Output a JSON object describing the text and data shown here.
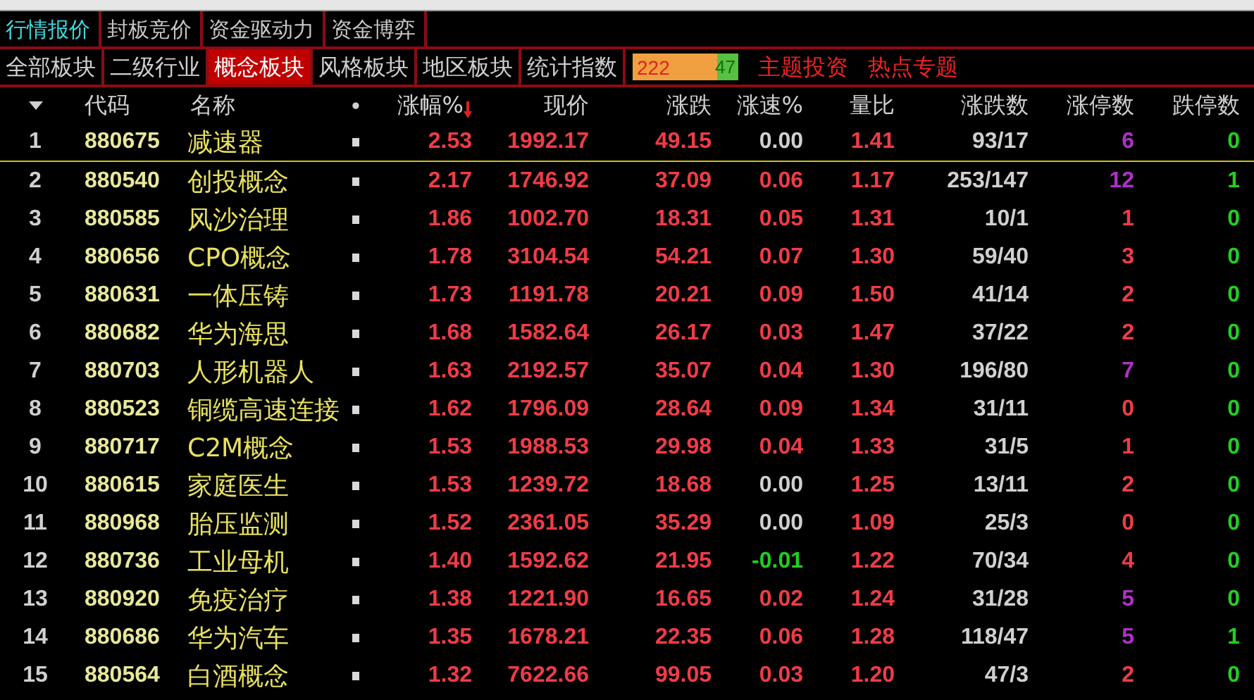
{
  "top_tabs": [
    {
      "label": "行情报价",
      "selected": true
    },
    {
      "label": "封板竞价",
      "selected": false
    },
    {
      "label": "资金驱动力",
      "selected": false
    },
    {
      "label": "资金博弈",
      "selected": false
    }
  ],
  "sector_tabs": [
    {
      "label": "全部板块",
      "selected": false
    },
    {
      "label": "二级行业",
      "selected": false
    },
    {
      "label": "概念板块",
      "selected": true
    },
    {
      "label": "风格板块",
      "selected": false
    },
    {
      "label": "地区板块",
      "selected": false
    },
    {
      "label": "统计指数",
      "selected": false
    }
  ],
  "breadth": {
    "up": "222",
    "down": "47",
    "level": 0.8
  },
  "links": [
    "主题投资",
    "热点专题"
  ],
  "table": {
    "columns": [
      {
        "label": "代码",
        "sorted": false
      },
      {
        "label": "名称",
        "sorted": false
      },
      {
        "label": "•",
        "sorted": false
      },
      {
        "label": "涨幅%",
        "sorted": true
      },
      {
        "label": "现价",
        "sorted": false
      },
      {
        "label": "涨跌",
        "sorted": false
      },
      {
        "label": "涨速%",
        "sorted": false
      },
      {
        "label": "量比",
        "sorted": false
      },
      {
        "label": "涨跌数",
        "sorted": false
      },
      {
        "label": "涨停数",
        "sorted": false
      },
      {
        "label": "跌停数",
        "sorted": false
      }
    ],
    "rows": [
      {
        "index": "1",
        "code": "880675",
        "name": "减速器",
        "change": "2.53",
        "price": "1992.17",
        "diff": "49.15",
        "speed": {
          "text": "0.00",
          "color": "#d0d0d0"
        },
        "ratio": "1.41",
        "updown": "93/17",
        "limit_up": {
          "text": "6",
          "color": "#b030c8"
        },
        "limit_down": "0",
        "selected": true
      },
      {
        "index": "2",
        "code": "880540",
        "name": "创投概念",
        "change": "2.17",
        "price": "1746.92",
        "diff": "37.09",
        "speed": {
          "text": "0.06",
          "color": "#f03c46"
        },
        "ratio": "1.17",
        "updown": "253/147",
        "limit_up": {
          "text": "12",
          "color": "#b030c8"
        },
        "limit_down": "1",
        "selected": false
      },
      {
        "index": "3",
        "code": "880585",
        "name": "风沙治理",
        "change": "1.86",
        "price": "1002.70",
        "diff": "18.31",
        "speed": {
          "text": "0.05",
          "color": "#f03c46"
        },
        "ratio": "1.31",
        "updown": "10/1",
        "limit_up": {
          "text": "1",
          "color": "#f03c46"
        },
        "limit_down": "0",
        "selected": false
      },
      {
        "index": "4",
        "code": "880656",
        "name": "CPO概念",
        "change": "1.78",
        "price": "3104.54",
        "diff": "54.21",
        "speed": {
          "text": "0.07",
          "color": "#f03c46"
        },
        "ratio": "1.30",
        "updown": "59/40",
        "limit_up": {
          "text": "3",
          "color": "#f03c46"
        },
        "limit_down": "0",
        "selected": false
      },
      {
        "index": "5",
        "code": "880631",
        "name": "一体压铸",
        "change": "1.73",
        "price": "1191.78",
        "diff": "20.21",
        "speed": {
          "text": "0.09",
          "color": "#f03c46"
        },
        "ratio": "1.50",
        "updown": "41/14",
        "limit_up": {
          "text": "2",
          "color": "#f03c46"
        },
        "limit_down": "0",
        "selected": false
      },
      {
        "index": "6",
        "code": "880682",
        "name": "华为海思",
        "change": "1.68",
        "price": "1582.64",
        "diff": "26.17",
        "speed": {
          "text": "0.03",
          "color": "#f03c46"
        },
        "ratio": "1.47",
        "updown": "37/22",
        "limit_up": {
          "text": "2",
          "color": "#f03c46"
        },
        "limit_down": "0",
        "selected": false
      },
      {
        "index": "7",
        "code": "880703",
        "name": "人形机器人",
        "change": "1.63",
        "price": "2192.57",
        "diff": "35.07",
        "speed": {
          "text": "0.04",
          "color": "#f03c46"
        },
        "ratio": "1.30",
        "updown": "196/80",
        "limit_up": {
          "text": "7",
          "color": "#b030c8"
        },
        "limit_down": "0",
        "selected": false
      },
      {
        "index": "8",
        "code": "880523",
        "name": "铜缆高速连接",
        "change": "1.62",
        "price": "1796.09",
        "diff": "28.64",
        "speed": {
          "text": "0.09",
          "color": "#f03c46"
        },
        "ratio": "1.34",
        "updown": "31/11",
        "limit_up": {
          "text": "0",
          "color": "#f03c46"
        },
        "limit_down": "0",
        "selected": false
      },
      {
        "index": "9",
        "code": "880717",
        "name": "C2M概念",
        "change": "1.53",
        "price": "1988.53",
        "diff": "29.98",
        "speed": {
          "text": "0.04",
          "color": "#f03c46"
        },
        "ratio": "1.33",
        "updown": "31/5",
        "limit_up": {
          "text": "1",
          "color": "#f03c46"
        },
        "limit_down": "0",
        "selected": false
      },
      {
        "index": "10",
        "code": "880615",
        "name": "家庭医生",
        "change": "1.53",
        "price": "1239.72",
        "diff": "18.68",
        "speed": {
          "text": "0.00",
          "color": "#d0d0d0"
        },
        "ratio": "1.25",
        "updown": "13/11",
        "limit_up": {
          "text": "2",
          "color": "#f03c46"
        },
        "limit_down": "0",
        "selected": false
      },
      {
        "index": "11",
        "code": "880968",
        "name": "胎压监测",
        "change": "1.52",
        "price": "2361.05",
        "diff": "35.29",
        "speed": {
          "text": "0.00",
          "color": "#d0d0d0"
        },
        "ratio": "1.09",
        "updown": "25/3",
        "limit_up": {
          "text": "0",
          "color": "#f03c46"
        },
        "limit_down": "0",
        "selected": false
      },
      {
        "index": "12",
        "code": "880736",
        "name": "工业母机",
        "change": "1.40",
        "price": "1592.62",
        "diff": "21.95",
        "speed": {
          "text": "-0.01",
          "color": "#20d020"
        },
        "ratio": "1.22",
        "updown": "70/34",
        "limit_up": {
          "text": "4",
          "color": "#f03c46"
        },
        "limit_down": "0",
        "selected": false
      },
      {
        "index": "13",
        "code": "880920",
        "name": "免疫治疗",
        "change": "1.38",
        "price": "1221.90",
        "diff": "16.65",
        "speed": {
          "text": "0.02",
          "color": "#f03c46"
        },
        "ratio": "1.24",
        "updown": "31/28",
        "limit_up": {
          "text": "5",
          "color": "#b030c8"
        },
        "limit_down": "0",
        "selected": false
      },
      {
        "index": "14",
        "code": "880686",
        "name": "华为汽车",
        "change": "1.35",
        "price": "1678.21",
        "diff": "22.35",
        "speed": {
          "text": "0.06",
          "color": "#f03c46"
        },
        "ratio": "1.28",
        "updown": "118/47",
        "limit_up": {
          "text": "5",
          "color": "#b030c8"
        },
        "limit_down": "1",
        "selected": false
      },
      {
        "index": "15",
        "code": "880564",
        "name": "白酒概念",
        "change": "1.32",
        "price": "7622.66",
        "diff": "99.05",
        "speed": {
          "text": "0.03",
          "color": "#f03c46"
        },
        "ratio": "1.20",
        "updown": "47/3",
        "limit_up": {
          "text": "2",
          "color": "#f03c46"
        },
        "limit_down": "0",
        "selected": false
      }
    ]
  }
}
